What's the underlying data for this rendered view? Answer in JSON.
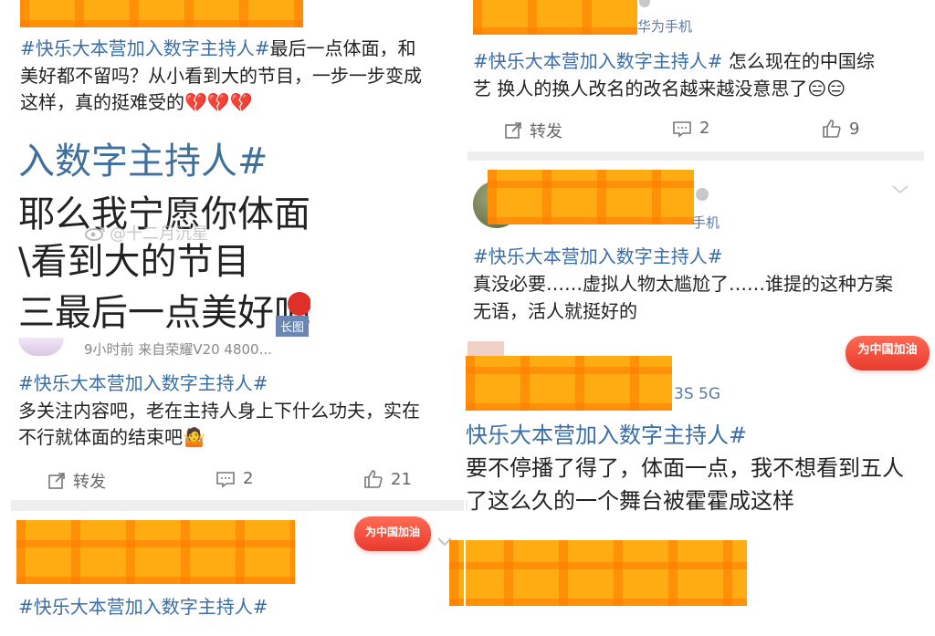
{
  "left": {
    "post1": {
      "hashtag": "#快乐大本营加入数字主持人#",
      "lines": [
        "最后一点体面，和",
        "美好都不留吗？从小看到大的节目，一步一步变成",
        "这样，真的挺难受的"
      ],
      "emoji": "💔💔💔"
    },
    "image": {
      "line1": "入数字主持人#",
      "line2": "耶么我宁愿你体面-",
      "line3": "\\看到大的节目",
      "line4": "三最后一点美好吧",
      "watermark": "@十二月沉星",
      "long_image_label": "长图"
    },
    "post2": {
      "meta": "9小时前  来自荣耀V20 4800...",
      "hashtag": "#快乐大本营加入数字主持人#",
      "line1": "多关注内容吧，老在主持人身上下什么功夫，实在",
      "line2": "不行就体面的结束吧🤷",
      "actions": {
        "repost": "转发",
        "comment": "2",
        "like": "21"
      }
    },
    "post3": {
      "badge": "为中国加油",
      "hashtag": "#快乐大本营加入数字主持人#"
    }
  },
  "right": {
    "post1": {
      "device": "华为手机",
      "hashtag": "#快乐大本营加入数字主持人#",
      "line1_rest": " 怎么现在的中国综",
      "line2": "艺 换人的换人改名的改名越来越没意思了😑😑",
      "actions": {
        "repost": "转发",
        "comment": "2",
        "like": "9"
      }
    },
    "post2": {
      "device": "手机",
      "hashtag": "#快乐大本营加入数字主持人#",
      "line1": "真没必要……虚拟人物太尴尬了……谁提的这种方案",
      "line2": "无语，活人就挺好的"
    },
    "post3": {
      "badge": "为中国加油",
      "device": "3S 5G",
      "hashtag": "快乐大本营加入数字主持人#",
      "line1": "要不停播了得了，体面一点，我不想看到五人",
      "line2": "了这么久的一个舞台被霍霍成这样"
    }
  }
}
